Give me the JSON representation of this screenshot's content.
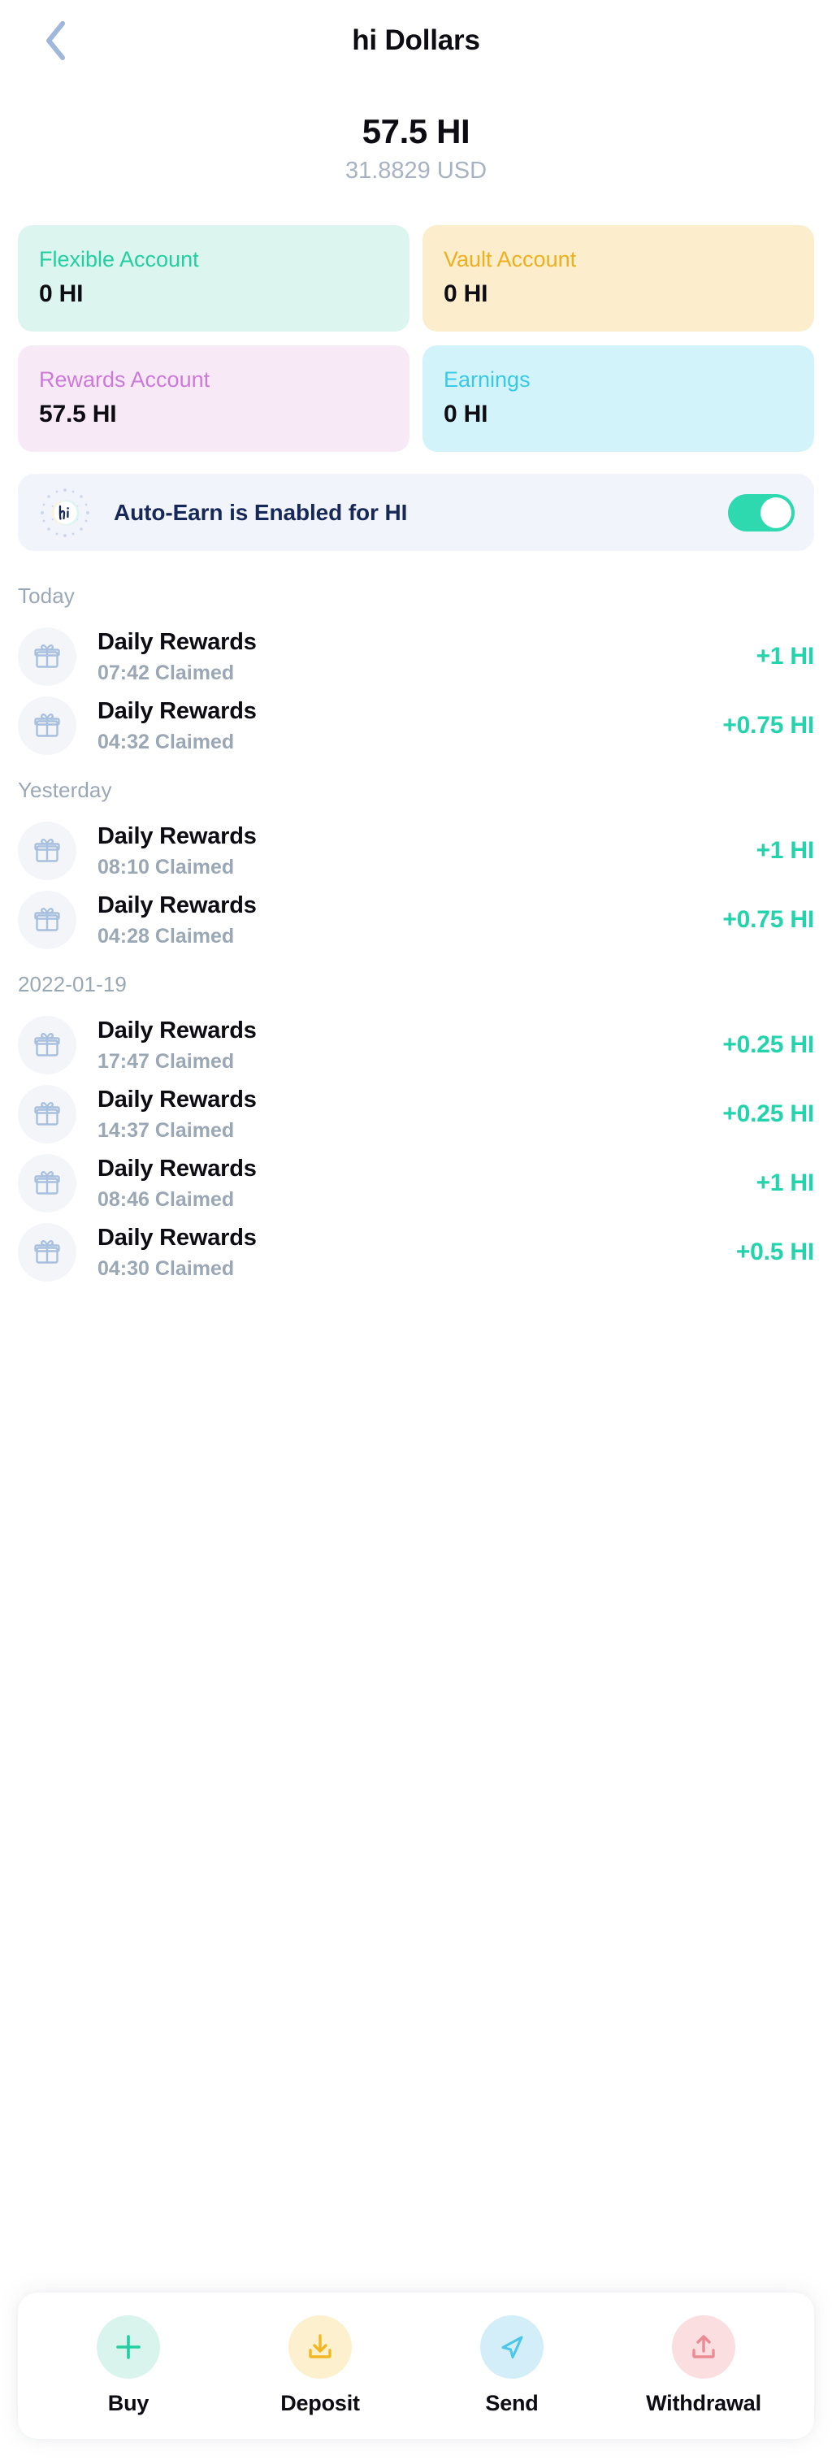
{
  "header": {
    "title": "hi Dollars",
    "back_icon": "chevron-left-icon"
  },
  "balance": {
    "amount": "57.5 HI",
    "fiat": "31.8829 USD"
  },
  "accounts": [
    {
      "label": "Flexible Account",
      "value": "0 HI",
      "key": "flexible",
      "accent": "#22cfa0",
      "bg": "#dcf6ef"
    },
    {
      "label": "Vault Account",
      "value": "0 HI",
      "key": "vault",
      "accent": "#ecb01e",
      "bg": "#fceecd"
    },
    {
      "label": "Rewards Account",
      "value": "57.5 HI",
      "key": "rewards",
      "accent": "#cc7ad8",
      "bg": "#f8e9f6"
    },
    {
      "label": "Earnings",
      "value": "0 HI",
      "key": "earnings",
      "accent": "#38c9e4",
      "bg": "#d3f3fa"
    }
  ],
  "auto_earn": {
    "text": "Auto-Earn is Enabled for HI",
    "logo_icon": "hi-logo-icon",
    "toggle_state": "on",
    "toggle_color": "#2ed9b0"
  },
  "transactions": {
    "groups": [
      {
        "header": "Today",
        "rows": [
          {
            "icon": "gift-icon",
            "title": "Daily Rewards",
            "subtitle": "07:42 Claimed",
            "amount": "+1 HI"
          },
          {
            "icon": "gift-icon",
            "title": "Daily Rewards",
            "subtitle": "04:32 Claimed",
            "amount": "+0.75 HI"
          }
        ]
      },
      {
        "header": "Yesterday",
        "rows": [
          {
            "icon": "gift-icon",
            "title": "Daily Rewards",
            "subtitle": "08:10 Claimed",
            "amount": "+1 HI"
          },
          {
            "icon": "gift-icon",
            "title": "Daily Rewards",
            "subtitle": "04:28 Claimed",
            "amount": "+0.75 HI"
          }
        ]
      },
      {
        "header": "2022-01-19",
        "rows": [
          {
            "icon": "gift-icon",
            "title": "Daily Rewards",
            "subtitle": "17:47 Claimed",
            "amount": "+0.25 HI"
          },
          {
            "icon": "gift-icon",
            "title": "Daily Rewards",
            "subtitle": "14:37 Claimed",
            "amount": "+0.25 HI"
          },
          {
            "icon": "gift-icon",
            "title": "Daily Rewards",
            "subtitle": "08:46 Claimed",
            "amount": "+1 HI"
          },
          {
            "icon": "gift-icon",
            "title": "Daily Rewards",
            "subtitle": "04:30 Claimed",
            "amount": "+0.5 HI"
          }
        ]
      }
    ],
    "amount_color": "#22d3ac"
  },
  "actions": [
    {
      "label": "Buy",
      "icon": "plus-icon",
      "bg": "#d8f4ec",
      "color": "#22cfa0"
    },
    {
      "label": "Deposit",
      "icon": "download-icon",
      "bg": "#fcf0cf",
      "color": "#f0b722"
    },
    {
      "label": "Send",
      "icon": "paper-plane-icon",
      "bg": "#d3eef9",
      "color": "#4cc7ea"
    },
    {
      "label": "Withdrawal",
      "icon": "upload-icon",
      "bg": "#fbdee0",
      "color": "#ec8a94"
    }
  ]
}
